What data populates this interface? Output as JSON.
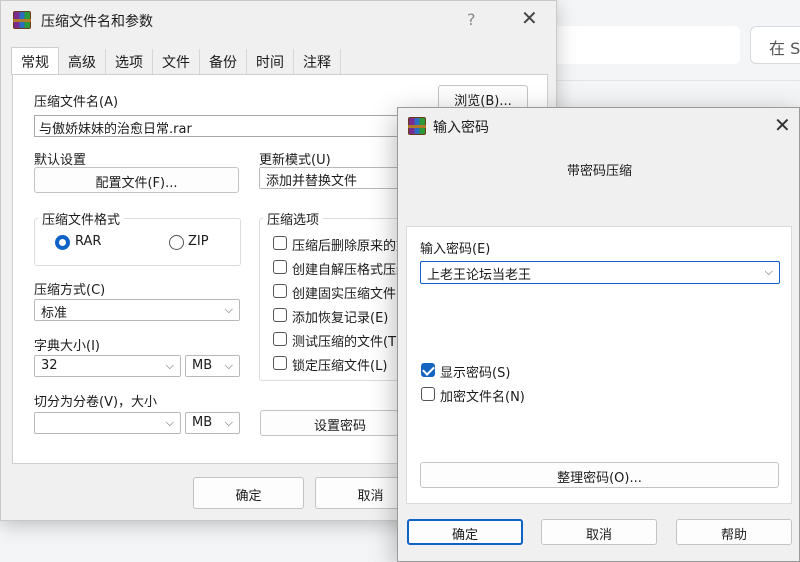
{
  "background": {
    "search_button_label": "在 S"
  },
  "main_dialog": {
    "title": "压缩文件名和参数",
    "help_glyph": "?",
    "close_glyph": "✕",
    "tabs": [
      "常规",
      "高级",
      "选项",
      "文件",
      "备份",
      "时间",
      "注释"
    ],
    "archive_name_label": "压缩文件名(A)",
    "archive_name_value": "与傲娇妹妹的治愈日常.rar",
    "browse_button": "浏览(B)...",
    "default_settings_label": "默认设置",
    "profiles_button": "配置文件(F)...",
    "update_mode_label": "更新模式(U)",
    "update_mode_value": "添加并替换文件",
    "format_group_label": "压缩文件格式",
    "format_rar": "RAR",
    "format_zip": "ZIP",
    "method_label": "压缩方式(C)",
    "method_value": "标准",
    "dict_label": "字典大小(I)",
    "dict_value": "32",
    "dict_unit": "MB",
    "split_label": "切分为分卷(V)，大小",
    "split_value": "",
    "split_unit": "MB",
    "options_group_label": "压缩选项",
    "options": [
      "压缩后删除原来的文",
      "创建自解压格式压缩",
      "创建固实压缩文件",
      "添加恢复记录(E)",
      "测试压缩的文件(T)",
      "锁定压缩文件(L)"
    ],
    "set_password_button": "设置密码",
    "ok_button": "确定",
    "cancel_button": "取消"
  },
  "password_dialog": {
    "title": "输入密码",
    "close_glyph": "✕",
    "subtitle": "带密码压缩",
    "password_label": "输入密码(E)",
    "password_value": "上老王论坛当老王",
    "show_password_label": "显示密码(S)",
    "show_password_checked": true,
    "encrypt_names_label": "加密文件名(N)",
    "encrypt_names_checked": false,
    "organize_button": "整理密码(O)...",
    "ok_button": "确定",
    "cancel_button": "取消",
    "help_button": "帮助"
  }
}
